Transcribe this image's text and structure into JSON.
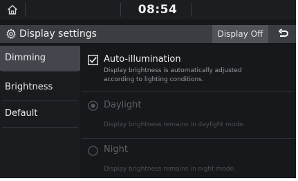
{
  "status": {
    "time": "08:54"
  },
  "title_bar": {
    "title": "Display settings",
    "display_off_label": "Display Off"
  },
  "sidebar": {
    "items": [
      {
        "label": "Dimming",
        "active": true
      },
      {
        "label": "Brightness",
        "active": false
      },
      {
        "label": "Default",
        "active": false
      }
    ]
  },
  "content": {
    "auto_illumination": {
      "label": "Auto-illumination",
      "description_line1": "Display brightness is automatically adjusted",
      "description_line2": "according to lighting conditions.",
      "checked": true
    },
    "daylight": {
      "label": "Daylight",
      "description": "Display brightness remains in daylight mode.",
      "selected": true,
      "enabled": false
    },
    "night": {
      "label": "Night",
      "description": "Display brightness remains in night mode.",
      "selected": false,
      "enabled": false
    }
  },
  "icons": {
    "home": "home-icon",
    "gear": "gear-icon",
    "back": "back-arrow-icon",
    "checkbox": "checkbox-checked-icon",
    "radio_selected": "radio-selected-icon",
    "radio_unselected": "radio-unselected-icon"
  },
  "colors": {
    "background": "#16171a",
    "title_bar": "#3b3d42",
    "active_tab": "#43464c",
    "text": "#f0f0f0",
    "disabled_text": "#5e6065"
  }
}
